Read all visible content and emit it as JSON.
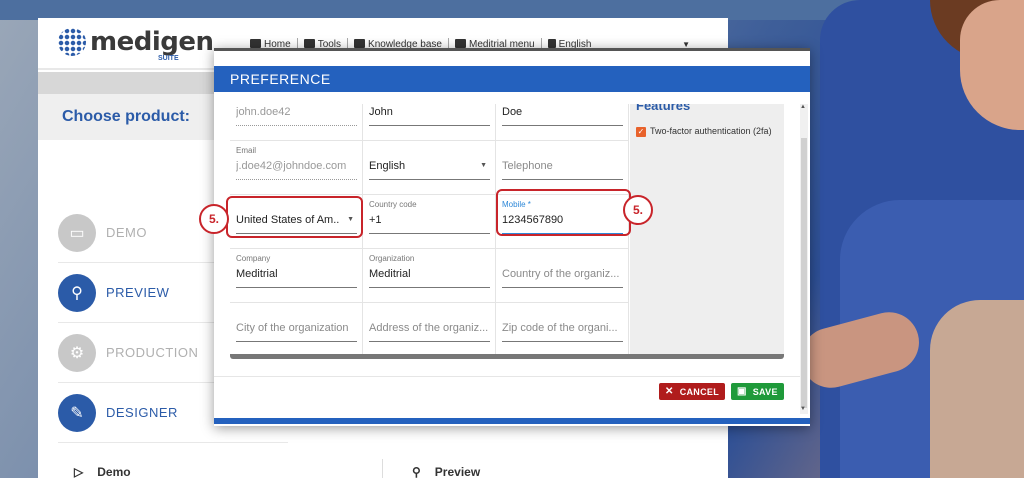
{
  "logo": {
    "word": "medigen",
    "suite": "SUITE"
  },
  "topnav": {
    "home": "Home",
    "tools": "Tools",
    "knowledge_base": "Knowledge base",
    "meditrial_menu": "Meditrial menu",
    "language": "English"
  },
  "choose_product": "Choose product:",
  "products": [
    {
      "label": "DEMO",
      "icon": "monitor-icon"
    },
    {
      "label": "PREVIEW",
      "icon": "search-icon"
    },
    {
      "label": "PRODUCTION",
      "icon": "gear-icon"
    },
    {
      "label": "DESIGNER",
      "icon": "edit-icon"
    }
  ],
  "bottom_tabs": {
    "demo": "Demo",
    "preview": "Preview"
  },
  "modal": {
    "title": "PREFERENCE",
    "rows": [
      [
        {
          "label": "",
          "value": "john.doe42",
          "style": "grey"
        },
        {
          "label": "",
          "value": "John"
        },
        {
          "label": "",
          "value": "Doe"
        }
      ],
      [
        {
          "label": "Email",
          "value": "j.doe42@johndoe.com",
          "style": "grey"
        },
        {
          "label": "",
          "value": "English",
          "dropdown": true
        },
        {
          "label": "",
          "value": "Telephone",
          "style": "placeholder"
        }
      ],
      [
        {
          "label": "",
          "value": "United States of Am...",
          "dropdown": true
        },
        {
          "label": "Country code",
          "value": "+1"
        },
        {
          "label": "Mobile *",
          "value": "1234567890",
          "focused": true
        }
      ],
      [
        {
          "label": "Company",
          "value": "Meditrial"
        },
        {
          "label": "Organization",
          "value": "Meditrial"
        },
        {
          "label": "",
          "value": "Country of the organiz...",
          "style": "placeholder"
        }
      ],
      [
        {
          "label": "",
          "value": "City of the organization",
          "style": "placeholder"
        },
        {
          "label": "",
          "value": "Address of the organiz...",
          "style": "placeholder"
        },
        {
          "label": "",
          "value": "Zip code of the organi...",
          "style": "placeholder"
        }
      ]
    ],
    "features_title": "Features",
    "two_factor": "Two-factor authentication (2fa)",
    "cancel": "CANCEL",
    "save": "SAVE"
  },
  "callouts": {
    "left": "5.",
    "right": "5."
  },
  "colors": {
    "accent": "#2461be",
    "cancel": "#b01c1c",
    "save": "#1f9a3a",
    "callout": "#c8242a",
    "checkbox": "#e8622b"
  }
}
